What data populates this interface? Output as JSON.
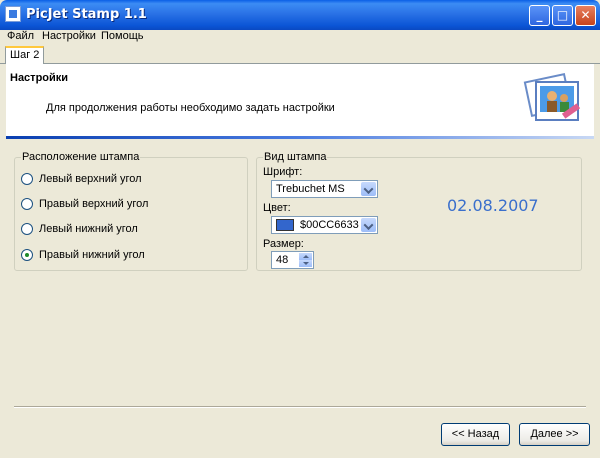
{
  "window": {
    "title": "PicJet Stamp 1.1",
    "min_glyph": "_",
    "max_glyph": "□",
    "close_glyph": "✕"
  },
  "menu": {
    "items": [
      "Файл",
      "Настройки",
      "Помощь"
    ]
  },
  "tabs": [
    {
      "label": "Шаг 2",
      "active": true
    }
  ],
  "header": {
    "title": "Настройки",
    "subtitle": "Для продолжения работы необходимо задать настройки"
  },
  "position_group": {
    "label": "Расположение штампа",
    "options": [
      {
        "label": "Левый верхний угол",
        "checked": false
      },
      {
        "label": "Правый верхний угол",
        "checked": false
      },
      {
        "label": "Левый нижний угол",
        "checked": false
      },
      {
        "label": "Правый нижний угол",
        "checked": true
      }
    ]
  },
  "view_group": {
    "label": "Вид штампа",
    "font_label": "Шрифт:",
    "font_value": "Trebuchet MS",
    "color_label": "Цвет:",
    "color_value": "$00CC6633",
    "color_swatch": "#3366CC",
    "size_label": "Размер:",
    "size_value": "48"
  },
  "preview": {
    "text": "02.08.2007",
    "color": "#3A6FCC"
  },
  "buttons": {
    "back": "<< Назад",
    "next": "Далее >>"
  }
}
